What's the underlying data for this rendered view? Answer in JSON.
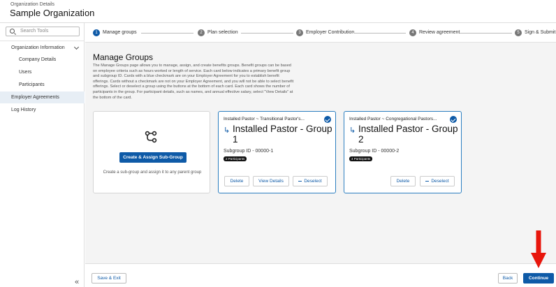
{
  "header": {
    "subtitle": "Organization Details",
    "title": "Sample Organization"
  },
  "sidebar": {
    "search_placeholder": "Search Tools",
    "items": [
      {
        "label": "Organization Information",
        "expandable": true
      },
      {
        "label": "Company Details"
      },
      {
        "label": "Users"
      },
      {
        "label": "Participants"
      },
      {
        "label": "Employer Agreements",
        "active": true
      },
      {
        "label": "Log History"
      }
    ],
    "collapse_glyph": "«"
  },
  "stepper": {
    "steps": [
      {
        "num": "1",
        "label": "Manage groups",
        "active": true
      },
      {
        "num": "2",
        "label": "Plan selection"
      },
      {
        "num": "3",
        "label": "Employer Contribution"
      },
      {
        "num": "4",
        "label": "Review agreement"
      },
      {
        "num": "5",
        "label": "Sign & Submit"
      }
    ]
  },
  "content": {
    "title": "Manage Groups",
    "description": "The Manage Groups page allows you to manage, assign, and create benefits groups. Benefit groups can be based on employee criteria such as hours worked or length of service. Each card below indicates a primary benefit group and subgroup ID. Cards with a blue checkmark are on your Employer Agreement for you to establish benefit offerings. Cards without a checkmark are not on your Employer Agreement, and you will not be able to select benefit offerings. Select or deselect a group using the buttons at the bottom of each card. Each card shows the number of participants in the group. For participant details, such as names, and annual effective salary, select \"View Details\" at the bottom of the card."
  },
  "create_card": {
    "button_label": "Create & Assign Sub-Group",
    "help_text": "Create a sub-group and assign it to any parent group"
  },
  "groups": [
    {
      "header": "Installed Pastor ~ Transitional Pastor's...",
      "name": "Installed Pastor - Group 1",
      "subgroup_id": "Subgroup ID - 00000-1",
      "participants": "2 Participants",
      "delete_label": "Delete",
      "view_label": "View Details",
      "deselect_label": "Deselect",
      "arrow_glyph": "↳"
    },
    {
      "header": "Installed Pastor ~ Congregational Pastors...",
      "name": "Installed Pastor - Group 2",
      "subgroup_id": "Subgroup ID - 00000-2",
      "participants": "4 Participants",
      "delete_label": "Delete",
      "deselect_label": "Deselect",
      "arrow_glyph": "↳"
    }
  ],
  "footer": {
    "save_exit": "Save & Exit",
    "back": "Back",
    "continue": "Continue"
  },
  "colors": {
    "primary": "#0e5aa7",
    "selected_border": "#2b7ec0",
    "annotation_arrow": "#e8160c"
  }
}
